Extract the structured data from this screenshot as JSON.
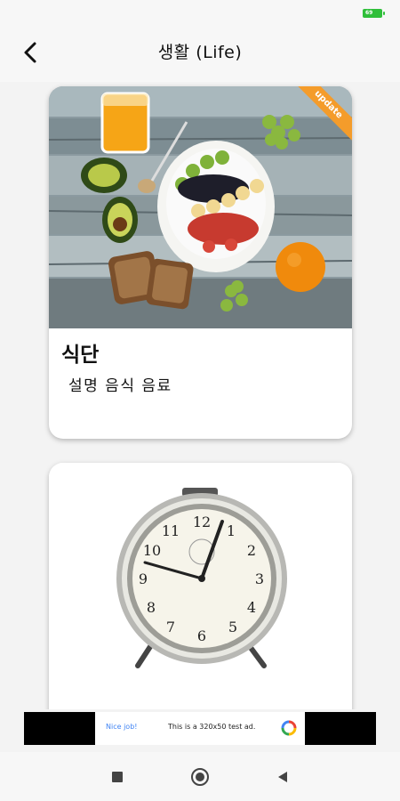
{
  "status_bar": {
    "battery": "69"
  },
  "header": {
    "title": "생활 (Life)"
  },
  "cards": [
    {
      "title": "식단",
      "subtitle": "설명 음식 음료",
      "badge": "update"
    },
    {
      "title": "",
      "subtitle": ""
    }
  ],
  "ad": {
    "nice_label": "Nice job!",
    "text": "This is a 320x50 test ad."
  },
  "colors": {
    "accent_badge": "#f49c2b",
    "battery": "#2fbf3a"
  }
}
